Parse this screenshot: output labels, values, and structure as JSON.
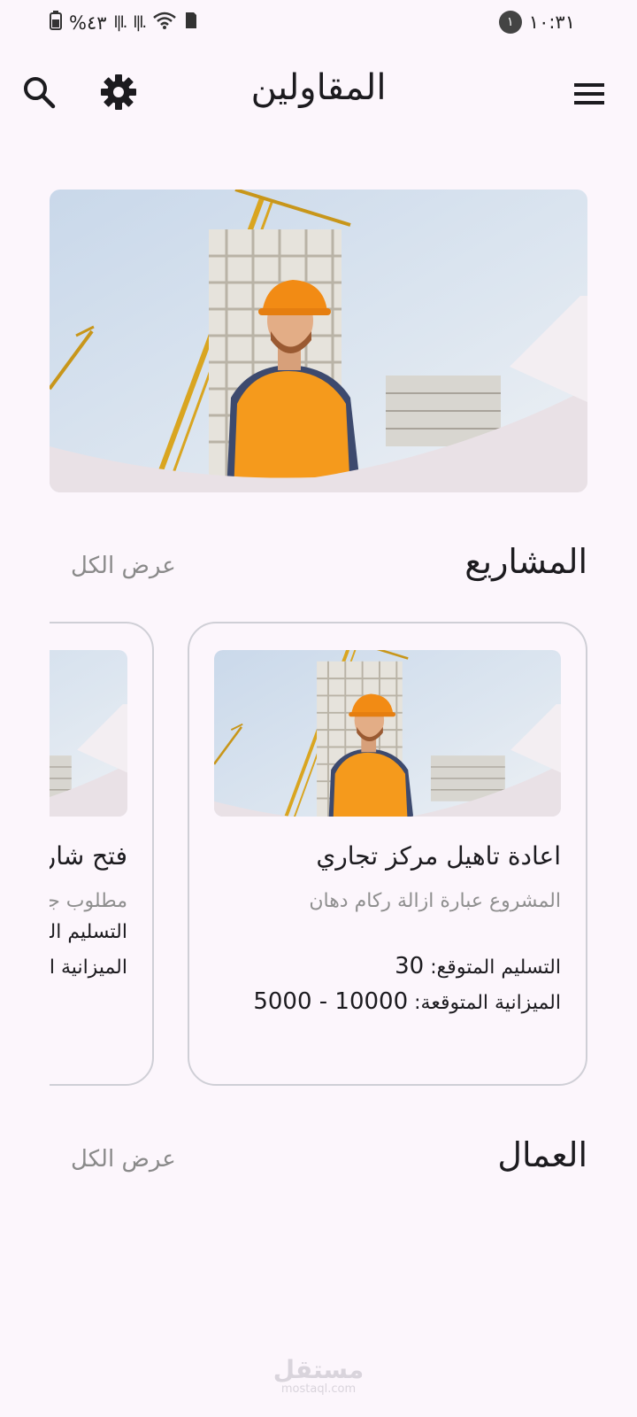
{
  "status_bar": {
    "time": "١٠:٣١",
    "notification_count": "١",
    "battery": "%٤٣"
  },
  "app_bar": {
    "title": "المقاولين"
  },
  "projects_section": {
    "title": "المشاريع",
    "view_all": "عرض الكل",
    "cards": [
      {
        "title": "اعادة تاهيل مركز تجاري",
        "description": "المشروع عبارة ازالة ركام دهان",
        "delivery_label": "التسليم المتوقع:",
        "delivery_value": "30",
        "budget_label": "الميزانية المتوقعة:",
        "budget_value": "5000 - 10000"
      },
      {
        "title": "فتح شار",
        "description": "مطلوب جرا",
        "delivery_label": "التسليم المت",
        "budget_label": "الميزانية الم"
      }
    ]
  },
  "workers_section": {
    "title": "العمال",
    "view_all": "عرض الكل"
  },
  "watermark": {
    "arabic": "مستقل",
    "latin": "mostaql.com"
  }
}
